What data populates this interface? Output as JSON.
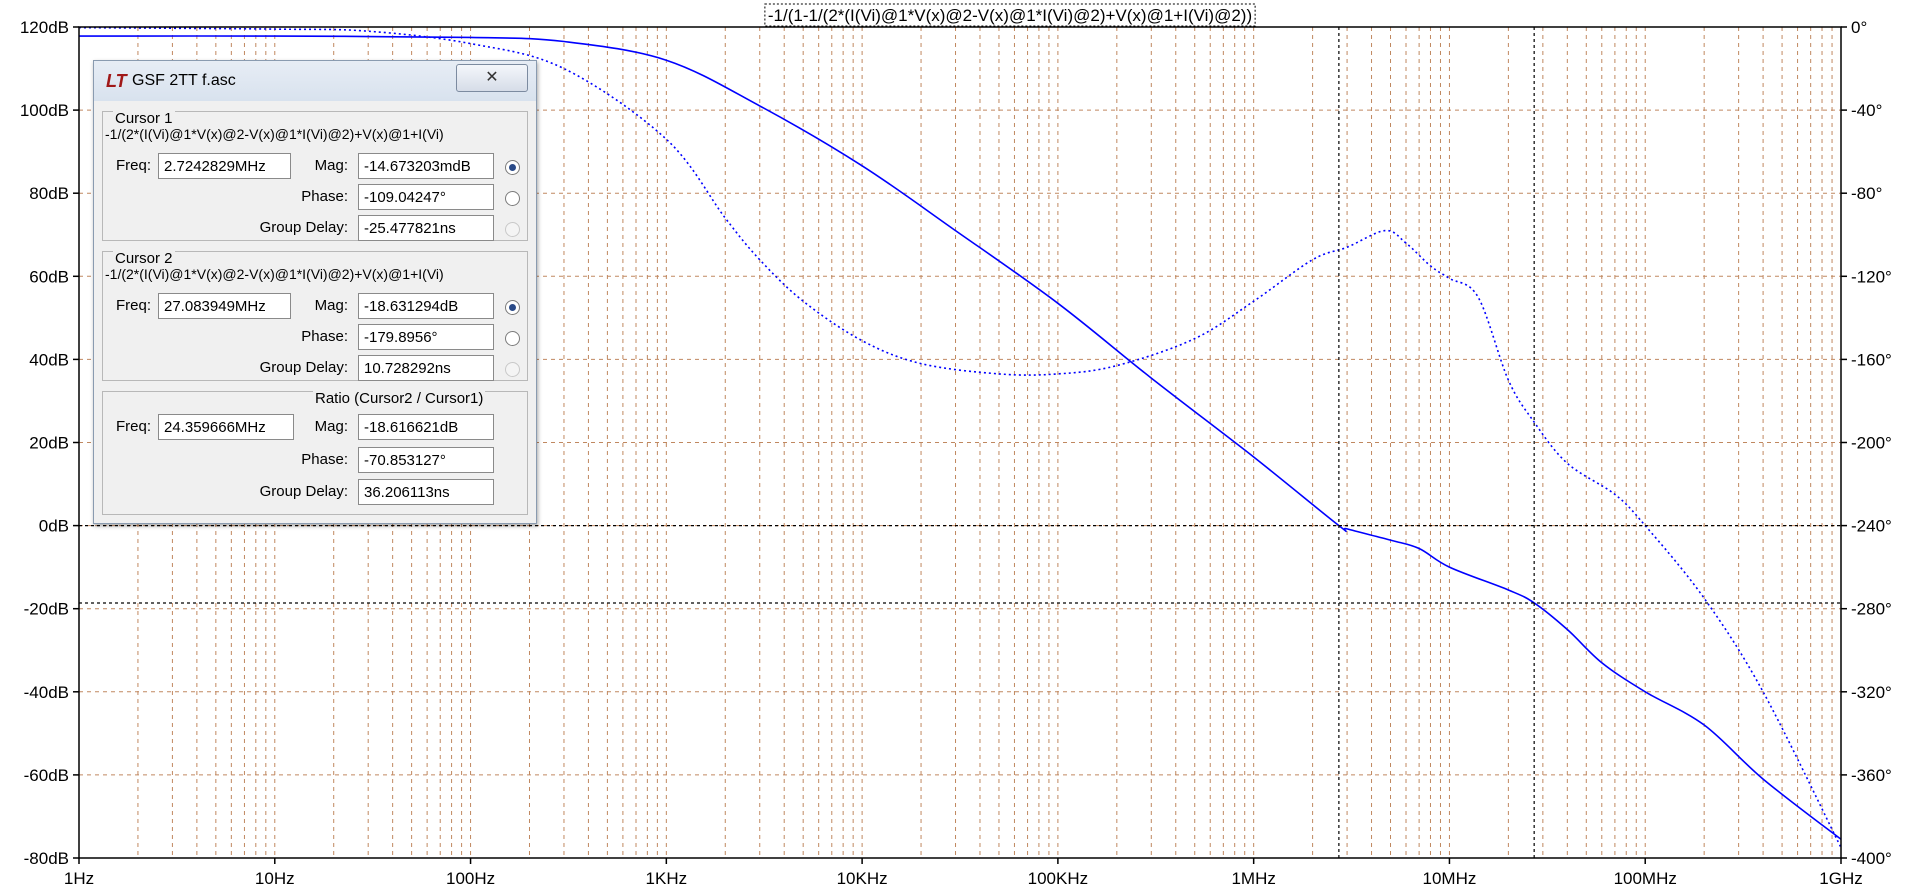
{
  "window_title": "GSF 2TT f.asc",
  "cursor_dialog": {
    "logo": "LT",
    "title": "GSF 2TT f.asc",
    "close_icon": "close-icon",
    "cursor1": {
      "title": "Cursor 1",
      "expression": "-1/(2*(I(Vi)@1*V(x)@2-V(x)@1*I(Vi)@2)+V(x)@1+I(Vi)",
      "freq_label": "Freq:",
      "freq": "2.7242829MHz",
      "mag_label": "Mag:",
      "mag": "-14.673203mdB",
      "phase_label": "Phase:",
      "phase": "-109.04247°",
      "gd_label": "Group Delay:",
      "gd": "-25.477821ns"
    },
    "cursor2": {
      "title": "Cursor 2",
      "expression": "-1/(2*(I(Vi)@1*V(x)@2-V(x)@1*I(Vi)@2)+V(x)@1+I(Vi)",
      "freq_label": "Freq:",
      "freq": "27.083949MHz",
      "mag_label": "Mag:",
      "mag": "-18.631294dB",
      "phase_label": "Phase:",
      "phase": "-179.8956°",
      "gd_label": "Group Delay:",
      "gd": "10.728292ns"
    },
    "ratio": {
      "title": "Ratio (Cursor2 / Cursor1)",
      "freq_label": "Freq:",
      "freq": "24.359666MHz",
      "mag_label": "Mag:",
      "mag": "-18.616621dB",
      "phase_label": "Phase:",
      "phase": "-70.853127°",
      "gd_label": "Group Delay:",
      "gd": "36.206113ns"
    }
  },
  "chart_data": {
    "type": "line",
    "title": "-1/(1-1/(2*(I(Vi)@1*V(x)@2-V(x)@1*I(Vi)@2)+V(x)@1+I(Vi)@2))",
    "x_scale": "log",
    "xlim": [
      1,
      1000000000
    ],
    "x_ticks": [
      {
        "v": 1,
        "label": "1Hz"
      },
      {
        "v": 10,
        "label": "10Hz"
      },
      {
        "v": 100,
        "label": "100Hz"
      },
      {
        "v": 1000,
        "label": "1KHz"
      },
      {
        "v": 10000,
        "label": "10KHz"
      },
      {
        "v": 100000,
        "label": "100KHz"
      },
      {
        "v": 1000000,
        "label": "1MHz"
      },
      {
        "v": 10000000,
        "label": "10MHz"
      },
      {
        "v": 100000000,
        "label": "100MHz"
      },
      {
        "v": 1000000000,
        "label": "1GHz"
      }
    ],
    "y_left": {
      "unit": "dB",
      "lim": [
        -80,
        120
      ],
      "ticks": [
        {
          "v": 120,
          "label": "120dB"
        },
        {
          "v": 100,
          "label": "100dB"
        },
        {
          "v": 80,
          "label": "80dB"
        },
        {
          "v": 60,
          "label": "60dB"
        },
        {
          "v": 40,
          "label": "40dB"
        },
        {
          "v": 20,
          "label": "20dB"
        },
        {
          "v": 0,
          "label": "0dB"
        },
        {
          "v": -20,
          "label": "-20dB"
        },
        {
          "v": -40,
          "label": "-40dB"
        },
        {
          "v": -60,
          "label": "-60dB"
        },
        {
          "v": -80,
          "label": "-80dB"
        }
      ]
    },
    "y_right": {
      "unit": "°",
      "lim": [
        -400,
        0
      ],
      "ticks": [
        {
          "v": 0,
          "label": "0°"
        },
        {
          "v": -40,
          "label": "-40°"
        },
        {
          "v": -80,
          "label": "-80°"
        },
        {
          "v": -120,
          "label": "-120°"
        },
        {
          "v": -160,
          "label": "-160°"
        },
        {
          "v": -200,
          "label": "-200°"
        },
        {
          "v": -240,
          "label": "-240°"
        },
        {
          "v": -280,
          "label": "-280°"
        },
        {
          "v": -320,
          "label": "-320°"
        },
        {
          "v": -360,
          "label": "-360°"
        },
        {
          "v": -400,
          "label": "-400°"
        }
      ]
    },
    "grid": true,
    "series": [
      {
        "kind": "magnitude",
        "axis": "left",
        "style": "solid",
        "color": "#0000ff",
        "points": [
          [
            1,
            117.8
          ],
          [
            10,
            117.8
          ],
          [
            100,
            117.5
          ],
          [
            300,
            116.5
          ],
          [
            1000,
            112
          ],
          [
            3000,
            101
          ],
          [
            10000,
            86.6
          ],
          [
            30000,
            71
          ],
          [
            100000,
            53.5
          ],
          [
            300000,
            35.5
          ],
          [
            1000000,
            16.5
          ],
          [
            2724283,
            0
          ],
          [
            3000000,
            -0.8
          ],
          [
            5000000,
            -3.5
          ],
          [
            7000000,
            -5.5
          ],
          [
            10000000,
            -10
          ],
          [
            20000000,
            -15.5
          ],
          [
            27083949,
            -18.6
          ],
          [
            40000000,
            -25
          ],
          [
            60000000,
            -33
          ],
          [
            100000000,
            -40
          ],
          [
            200000000,
            -48
          ],
          [
            400000000,
            -61
          ],
          [
            1000000000,
            -75.5
          ]
        ]
      },
      {
        "kind": "phase",
        "axis": "right",
        "style": "dotted",
        "color": "#0000ff",
        "points": [
          [
            1,
            -0.3
          ],
          [
            10,
            -1
          ],
          [
            30,
            -2
          ],
          [
            100,
            -8
          ],
          [
            300,
            -20
          ],
          [
            1000,
            -54
          ],
          [
            2000,
            -92
          ],
          [
            3000,
            -112
          ],
          [
            5000,
            -132
          ],
          [
            10000,
            -151
          ],
          [
            20000,
            -162
          ],
          [
            50000,
            -167
          ],
          [
            100000,
            -167
          ],
          [
            200000,
            -163
          ],
          [
            500000,
            -150
          ],
          [
            1000000,
            -132
          ],
          [
            2000000,
            -112
          ],
          [
            3000000,
            -106
          ],
          [
            4700000,
            -98
          ],
          [
            6000000,
            -104
          ],
          [
            8000000,
            -115
          ],
          [
            10000000,
            -121
          ],
          [
            14000000,
            -130
          ],
          [
            20000000,
            -170
          ],
          [
            27000000,
            -190
          ],
          [
            40000000,
            -210
          ],
          [
            70000000,
            -225
          ],
          [
            100000000,
            -240
          ],
          [
            200000000,
            -275
          ],
          [
            400000000,
            -320
          ],
          [
            1000000000,
            -395
          ]
        ]
      }
    ],
    "cursors": [
      {
        "name": "Cursor 1",
        "freq": 2724283,
        "mag_db": -0.0147
      },
      {
        "name": "Cursor 2",
        "freq": 27083949,
        "mag_db": -18.63
      }
    ]
  }
}
